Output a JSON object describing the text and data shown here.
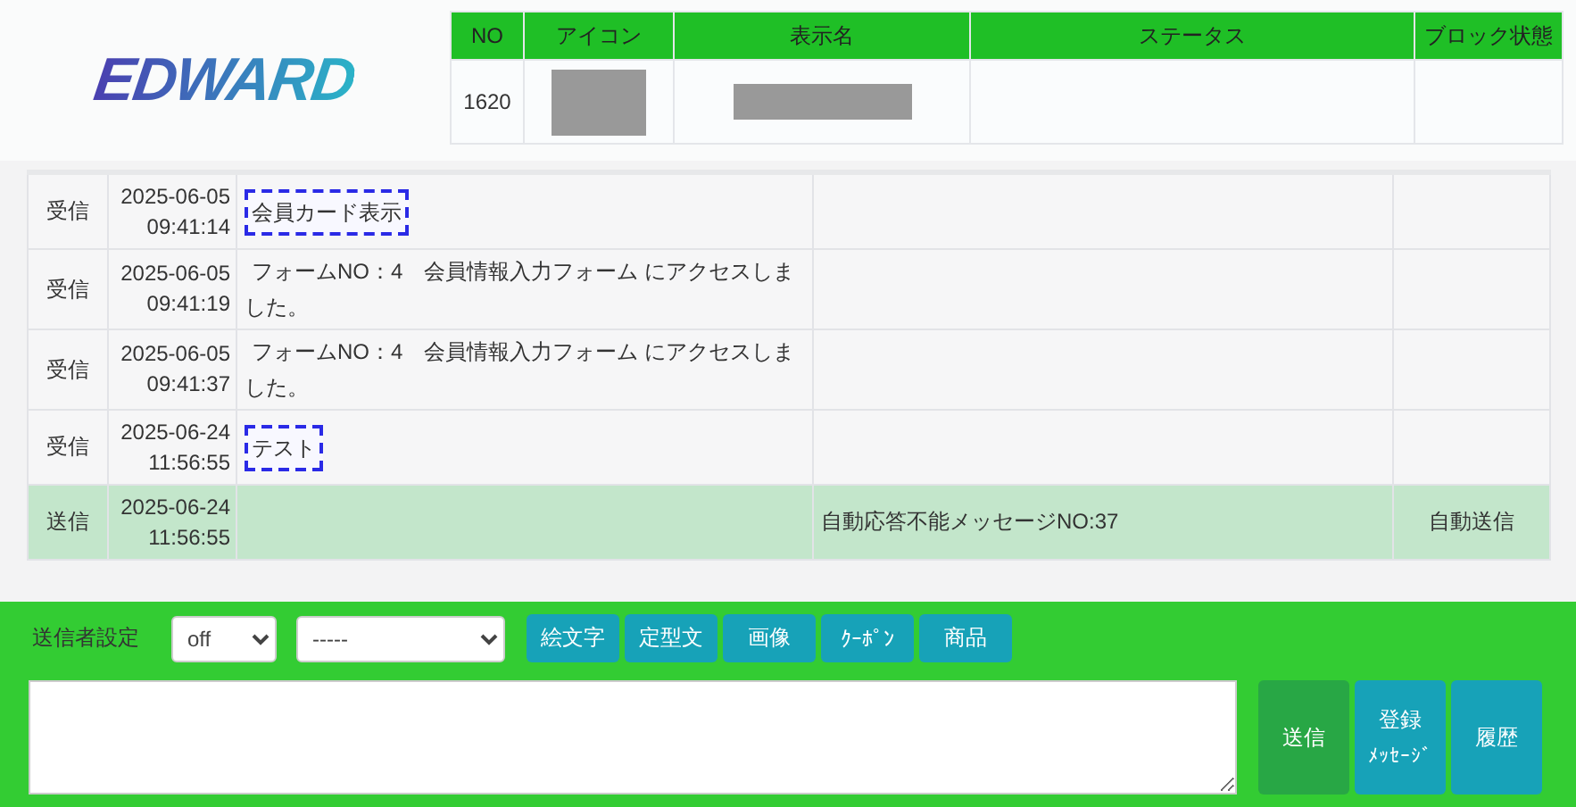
{
  "logo": {
    "text": "EDWARD"
  },
  "profile": {
    "columns": [
      "NO",
      "アイコン",
      "表示名",
      "ステータス",
      "ブロック状態"
    ],
    "row": {
      "no": "1620",
      "icon": {
        "kind": "redacted"
      },
      "display_name": {
        "kind": "redacted"
      }
    }
  },
  "messages": [
    {
      "direction": "受信",
      "date": "2025-06-05",
      "time": "09:41:14",
      "text": "会員カード表示",
      "boxed": true,
      "kind": "received"
    },
    {
      "direction": "受信",
      "date": "2025-06-05",
      "time": "09:41:19",
      "text": "フォームNO：4　会員情報入力フォーム にアクセスしました。",
      "boxed": false,
      "kind": "received"
    },
    {
      "direction": "受信",
      "date": "2025-06-05",
      "time": "09:41:37",
      "text": "フォームNO：4　会員情報入力フォーム にアクセスしました。",
      "boxed": false,
      "kind": "received"
    },
    {
      "direction": "受信",
      "date": "2025-06-24",
      "time": "11:56:55",
      "text": "テスト",
      "boxed": true,
      "kind": "received"
    },
    {
      "direction": "送信",
      "date": "2025-06-24",
      "time": "11:56:55",
      "column_4": "自動応答不能メッセージNO:37",
      "column_5": "自動送信",
      "kind": "sent"
    }
  ],
  "composer": {
    "sender_label": "送信者設定",
    "sender_select": "off",
    "template_select": "-----",
    "tool_buttons": [
      "絵文字",
      "定型文",
      "画像",
      "ｸｰﾎﾟﾝ",
      "商品"
    ],
    "actions": [
      {
        "label": "送信",
        "kind": "primary"
      },
      {
        "label": "登録",
        "sublabel": "ﾒｯｾｰｼﾞ",
        "kind": "info"
      },
      {
        "label": "履歴",
        "kind": "info"
      }
    ]
  }
}
